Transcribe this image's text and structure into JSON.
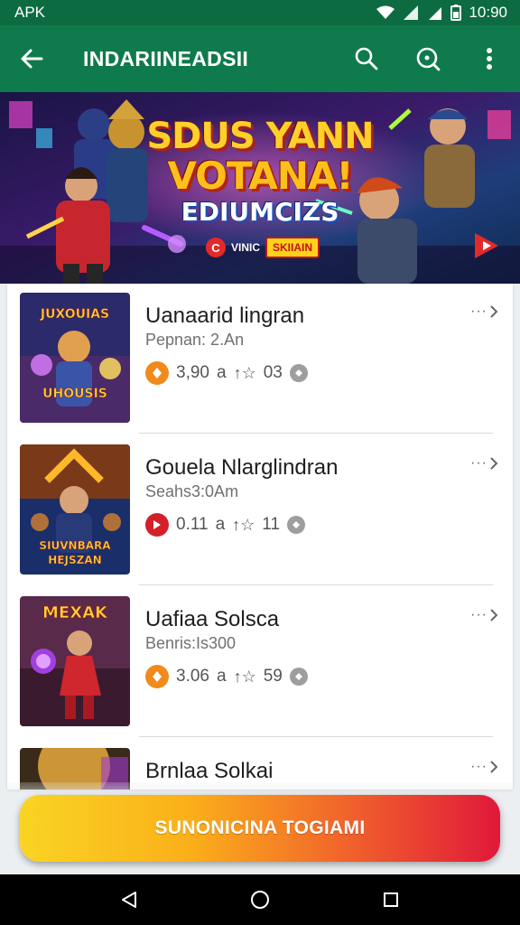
{
  "status_bar": {
    "carrier": "APK",
    "time": "10:90"
  },
  "app_bar": {
    "title": "INDARIINEADSII",
    "icons": [
      "back-arrow-icon",
      "search-icon",
      "search-alt-icon",
      "more-vert-icon"
    ]
  },
  "banner": {
    "headline_1": "SDUS YANN",
    "headline_2": "VOTANA!",
    "headline_3": "EDIUMCIZS",
    "badge_small": "C",
    "badge_text": "VINIC",
    "badge_pill": "SKIIAIN"
  },
  "apps": [
    {
      "name": "Uanaarid lingran",
      "subtitle": "Pepnan: 2.An",
      "rating": "3,90",
      "meta_a": "a",
      "meta_count": "03",
      "badge_color": "#f08a1c",
      "thumb_text": "JUXOUIAS",
      "thumb_text_2": "UHOUSIS",
      "more": "···"
    },
    {
      "name": "Gouela Nlarglindran",
      "subtitle": "Seahs3:0Am",
      "rating": "0.11",
      "meta_a": "a",
      "meta_count": "11",
      "badge_color": "#d3202a",
      "thumb_text": "SIUVNBARA",
      "thumb_text_2": "HEJSZAN",
      "more": "···"
    },
    {
      "name": "Uafiaa Solsca",
      "subtitle": "Benris:Is300",
      "rating": "3.06",
      "meta_a": "a",
      "meta_count": "59",
      "badge_color": "#f08a1c",
      "thumb_text": "MEXAK",
      "thumb_text_2": "",
      "more": "···"
    },
    {
      "name": "Brnlaa Solkai",
      "subtitle": "",
      "rating": "",
      "meta_a": "",
      "meta_count": "",
      "badge_color": "#f08a1c",
      "thumb_text": "",
      "thumb_text_2": "",
      "more": "···"
    }
  ],
  "cta": {
    "label": "SUNONICINA TOGIAMI"
  },
  "nav_bar": {
    "icons": [
      "back-triangle-icon",
      "home-circle-icon",
      "recents-square-icon"
    ]
  }
}
